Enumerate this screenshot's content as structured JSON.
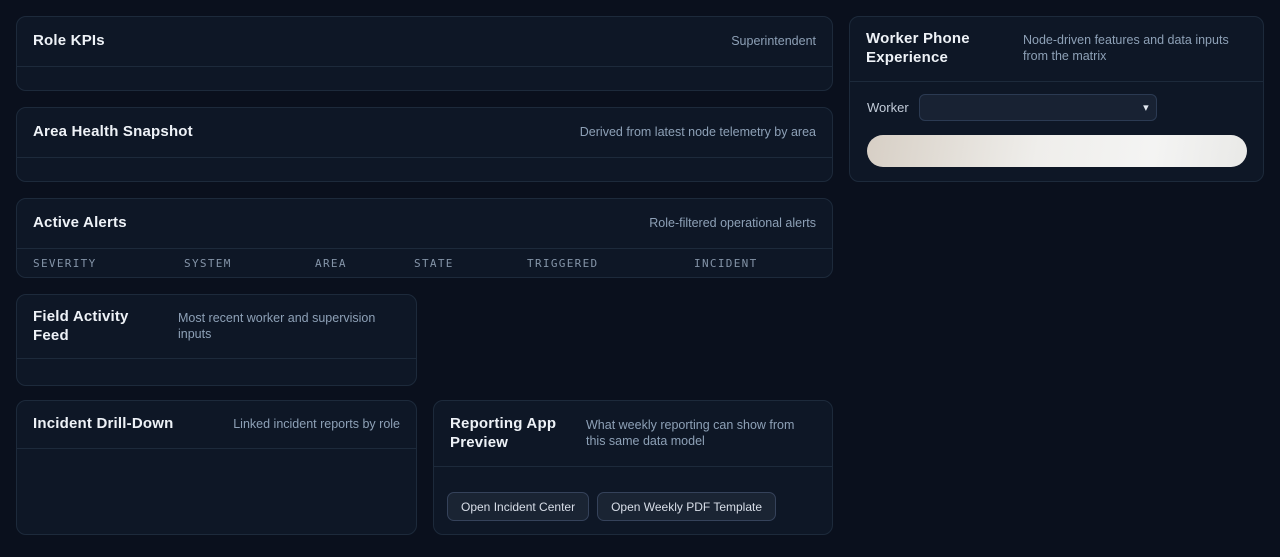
{
  "theme": {
    "page_bg": "#0a101d",
    "card_bg": "#0e1726",
    "phone_bar_color": "#e9e3da"
  },
  "cards": {
    "role_kpis": {
      "title": "Role KPIs",
      "meta": "Superintendent"
    },
    "area_health": {
      "title": "Area Health Snapshot",
      "meta": "Derived from latest node telemetry by area"
    },
    "active_alerts": {
      "title": "Active Alerts",
      "meta": "Role-filtered operational alerts",
      "columns": [
        "SEVERITY",
        "SYSTEM",
        "AREA",
        "STATE",
        "TRIGGERED",
        "INCIDENT"
      ],
      "rows": []
    },
    "field_activity": {
      "title": "Field Activity Feed",
      "meta": "Most recent worker and supervision inputs"
    },
    "incident_drilldown": {
      "title": "Incident Drill-Down",
      "meta": "Linked incident reports by role"
    },
    "reporting_preview": {
      "title": "Reporting App Preview",
      "meta": "What weekly reporting can show from this same data model",
      "buttons": [
        "Open Incident Center",
        "Open Weekly PDF Template"
      ]
    },
    "worker_phone": {
      "title": "Worker Phone Experience",
      "meta": "Node-driven features and data inputs from the matrix",
      "worker_label": "Worker",
      "worker_select_value": ""
    }
  }
}
